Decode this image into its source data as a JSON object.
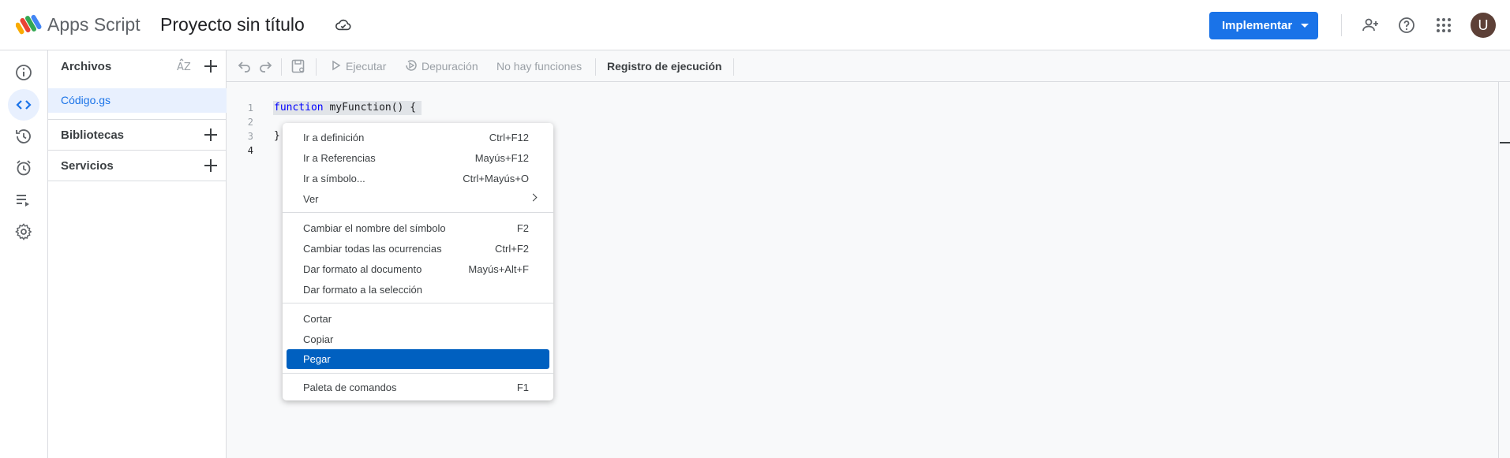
{
  "header": {
    "app_name": "Apps Script",
    "project_title": "Proyecto sin título",
    "deploy_label": "Implementar",
    "avatar_letter": "U"
  },
  "rail": {
    "icons": [
      "info-icon",
      "code-icon",
      "history-icon",
      "clock-icon",
      "executions-icon",
      "settings-icon"
    ]
  },
  "files_panel": {
    "files_label": "Archivos",
    "file_name": "Código.gs",
    "libraries_label": "Bibliotecas",
    "services_label": "Servicios"
  },
  "toolbar": {
    "run_label": "Ejecutar",
    "debug_label": "Depuración",
    "functions_label": "No hay funciones",
    "log_label": "Registro de ejecución"
  },
  "editor": {
    "line_numbers": [
      "1",
      "2",
      "3",
      "4"
    ],
    "code_line1_kw": "function",
    "code_line1_rest": " myFunction() {",
    "code_line3": "}"
  },
  "context_menu": {
    "items": [
      {
        "label": "Ir a definición",
        "shortcut": "Ctrl+F12"
      },
      {
        "label": "Ir a Referencias",
        "shortcut": "Mayús+F12"
      },
      {
        "label": "Ir a símbolo...",
        "shortcut": "Ctrl+Mayús+O"
      },
      {
        "label": "Ver",
        "shortcut": ""
      },
      {
        "label": "Cambiar el nombre del símbolo",
        "shortcut": "F2"
      },
      {
        "label": "Cambiar todas las ocurrencias",
        "shortcut": "Ctrl+F2"
      },
      {
        "label": "Dar formato al documento",
        "shortcut": "Mayús+Alt+F"
      },
      {
        "label": "Dar formato a la selección",
        "shortcut": ""
      },
      {
        "label": "Cortar",
        "shortcut": ""
      },
      {
        "label": "Copiar",
        "shortcut": ""
      },
      {
        "label": "Pegar",
        "shortcut": ""
      },
      {
        "label": "Paleta de comandos",
        "shortcut": "F1"
      }
    ],
    "selected_color": "#0060c0"
  },
  "colors": {
    "accent": "#1a73e8",
    "avatar": "#5d4037"
  }
}
